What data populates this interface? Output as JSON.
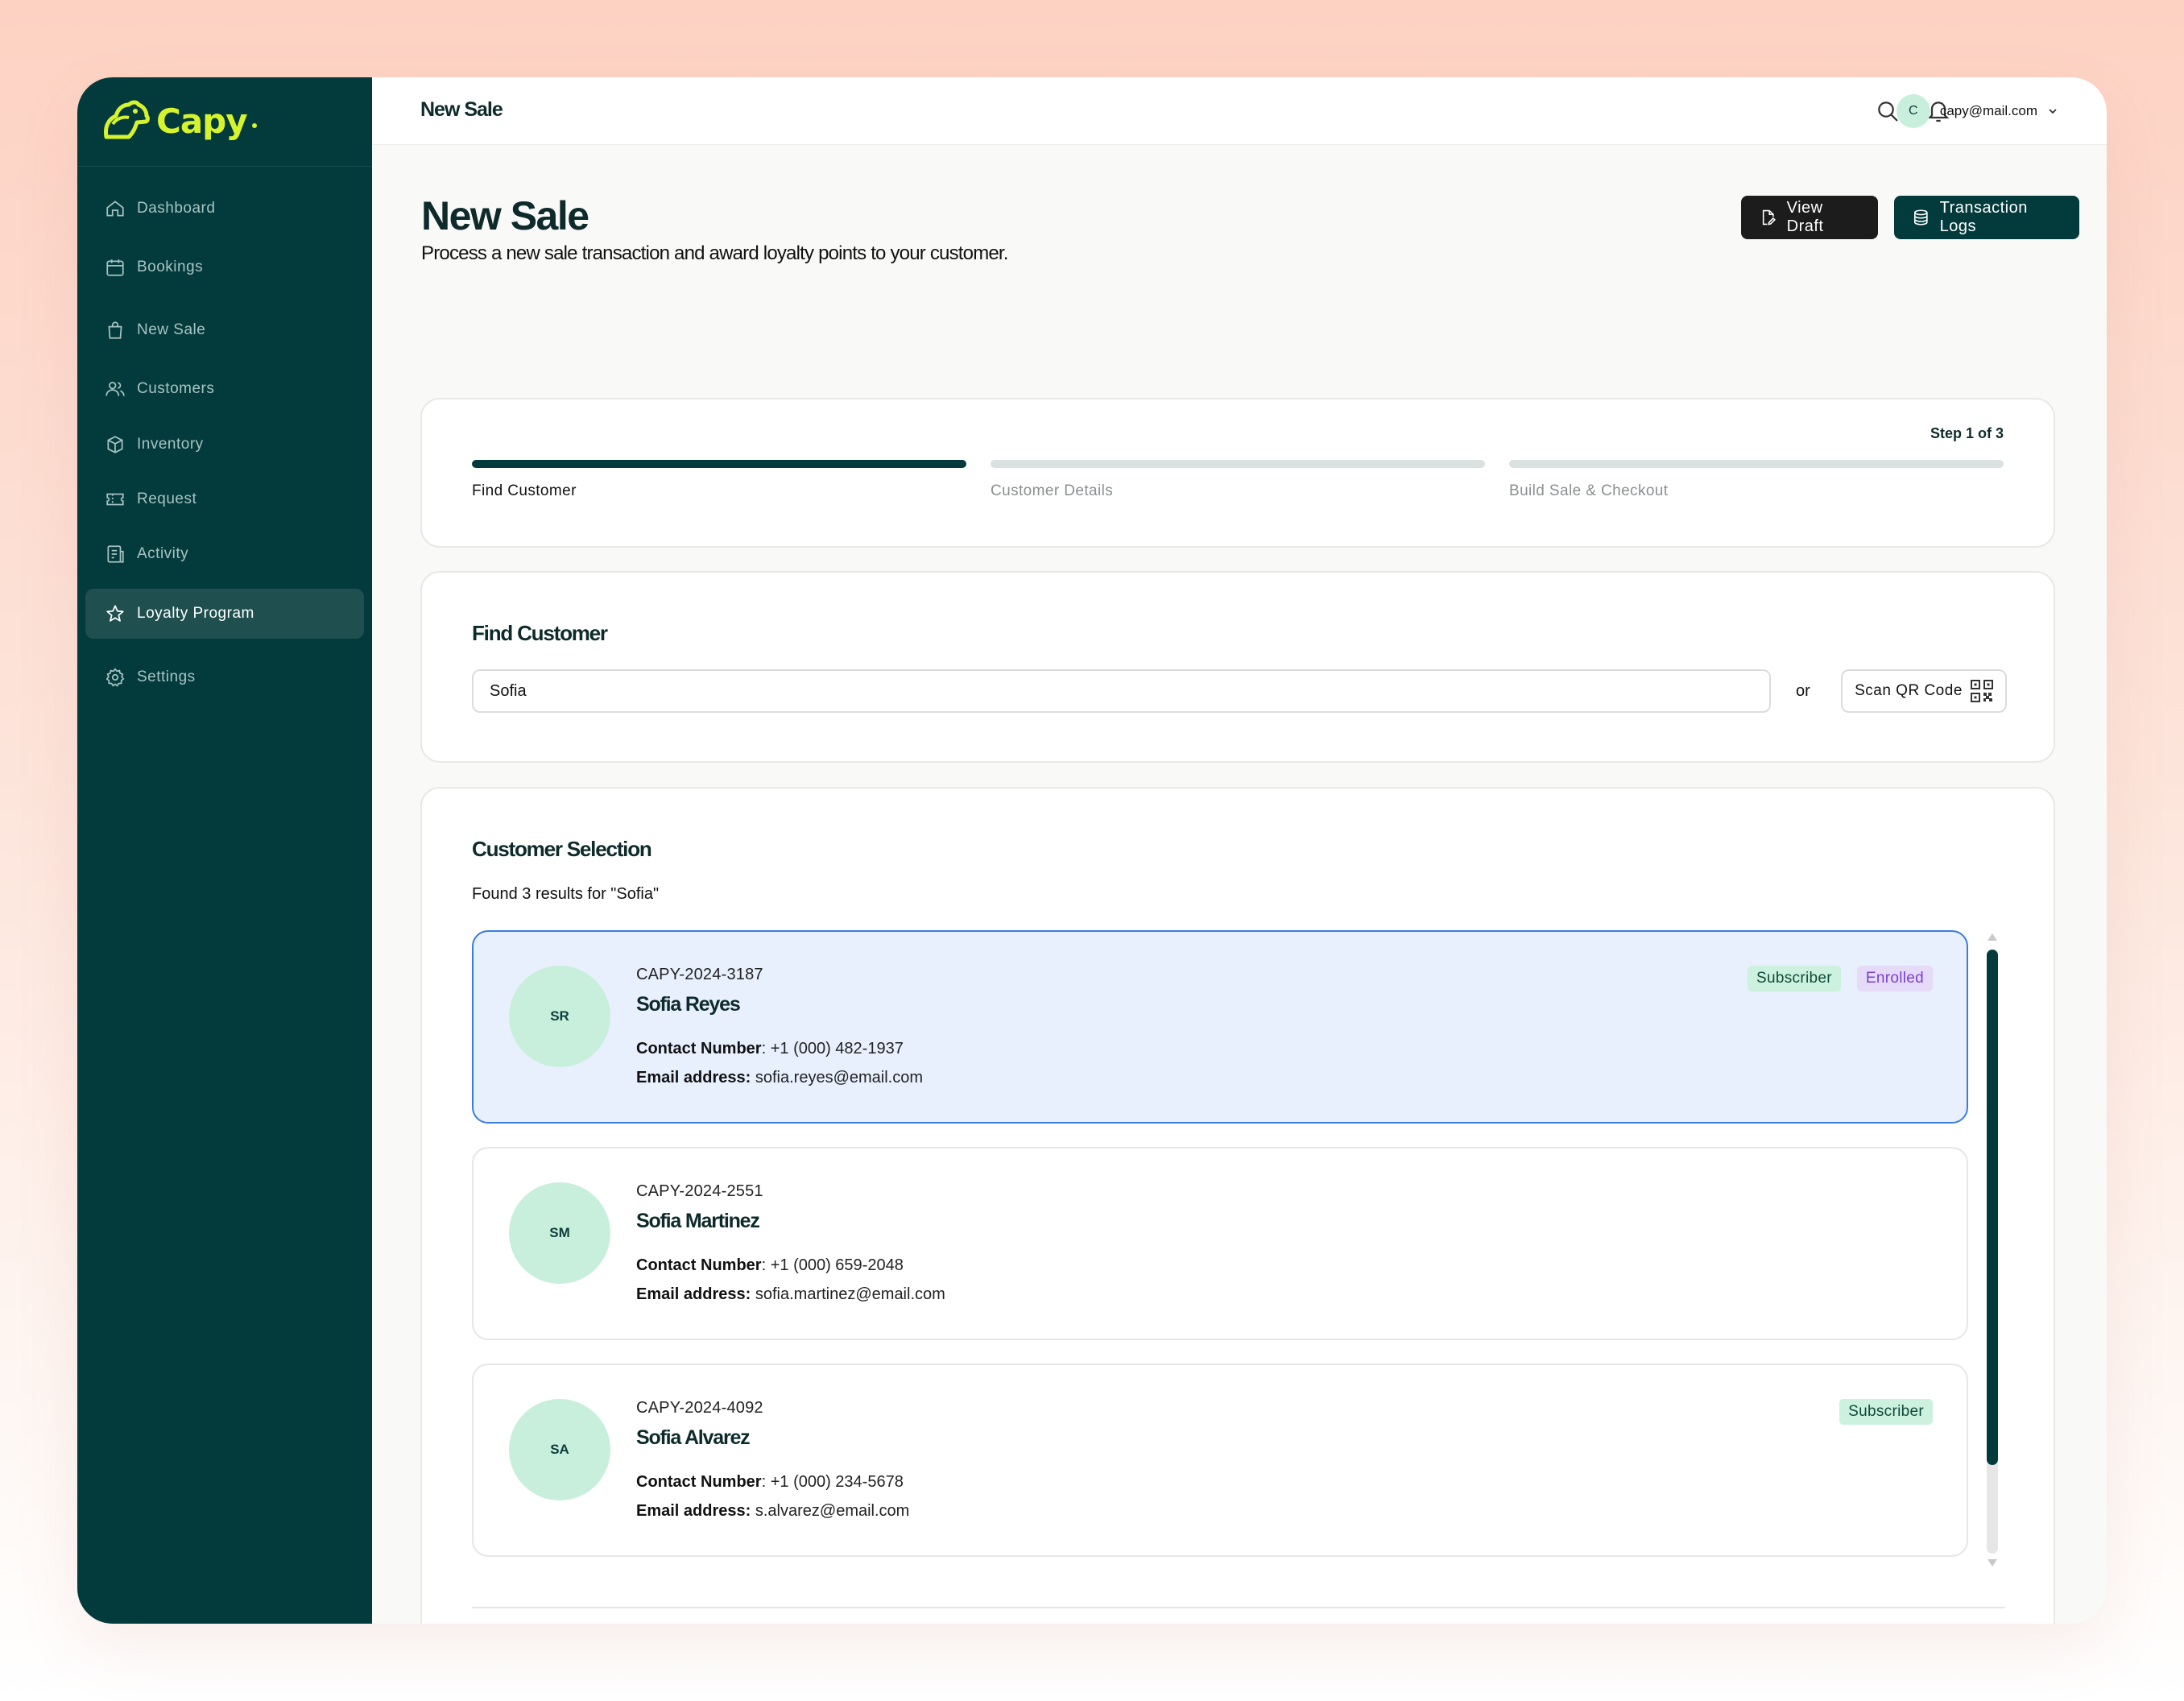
{
  "brand": {
    "name": "Capy",
    "accent": "#d7f32b",
    "sidebar_bg": "#033b3c"
  },
  "sidebar": {
    "items": [
      {
        "label": "Dashboard",
        "icon": "home-icon"
      },
      {
        "label": "Bookings",
        "icon": "calendar-icon"
      },
      {
        "label": "New Sale",
        "icon": "shopping-bag-icon"
      },
      {
        "label": "Customers",
        "icon": "users-icon"
      },
      {
        "label": "Inventory",
        "icon": "box-icon"
      },
      {
        "label": "Request",
        "icon": "ticket-icon"
      },
      {
        "label": "Activity",
        "icon": "clipboard-icon"
      },
      {
        "label": "Loyalty Program",
        "icon": "star-icon",
        "active": true
      },
      {
        "label": "Settings",
        "icon": "gear-icon"
      }
    ]
  },
  "topbar": {
    "title": "New Sale",
    "user": {
      "initial": "C",
      "email": "capy@mail.com"
    }
  },
  "page": {
    "title": "New Sale",
    "subtitle": "Process a new sale transaction and award loyalty points to your customer.",
    "buttons": {
      "view_draft": "View Draft",
      "transaction_logs": "Transaction Logs"
    }
  },
  "stepper": {
    "count_label": "Step 1 of 3",
    "steps": [
      {
        "label": "Find Customer",
        "active": true
      },
      {
        "label": "Customer Details",
        "active": false
      },
      {
        "label": "Build Sale & Checkout",
        "active": false
      }
    ]
  },
  "find_customer": {
    "title": "Find Customer",
    "search_value": "Sofia",
    "or_label": "or",
    "scan_label": "Scan QR Code"
  },
  "selection": {
    "title": "Customer Selection",
    "results_text": "Found 3 results for \"Sofia\"",
    "contact_label": "Contact Number",
    "email_label": "Email address:",
    "customers": [
      {
        "initials": "SR",
        "id": "CAPY-2024-3187",
        "name": "Sofia Reyes",
        "phone": "+1 (000) 482-1937",
        "email": "sofia.reyes@email.com",
        "badges": [
          "Subscriber",
          "Enrolled"
        ],
        "selected": true
      },
      {
        "initials": "SM",
        "id": "CAPY-2024-2551",
        "name": "Sofia Martinez",
        "phone": "+1 (000) 659-2048",
        "email": "sofia.martinez@email.com",
        "badges": [],
        "selected": false
      },
      {
        "initials": "SA",
        "id": "CAPY-2024-4092",
        "name": "Sofia Alvarez",
        "phone": "+1 (000) 234-5678",
        "email": "s.alvarez@email.com",
        "badges": [
          "Subscriber"
        ],
        "selected": false
      }
    ]
  }
}
